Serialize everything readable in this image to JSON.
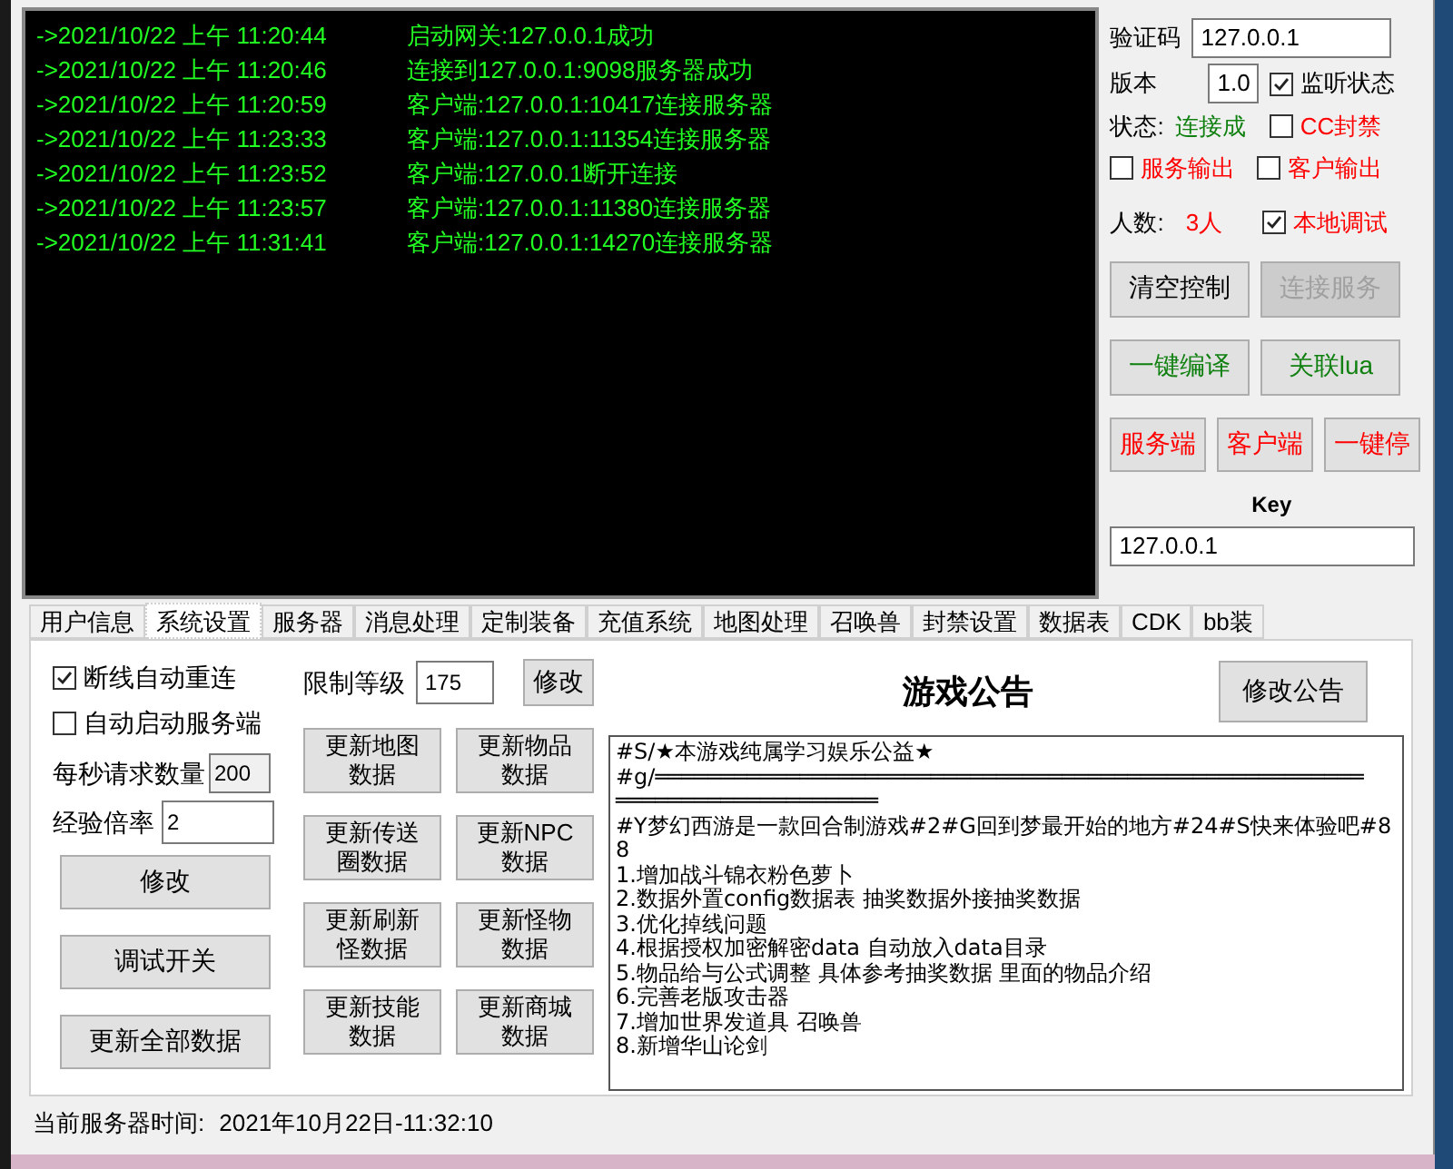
{
  "log": [
    {
      "time": "->2021/10/22 上午 11:20:44",
      "message": "启动网关:127.0.0.1成功"
    },
    {
      "time": "->2021/10/22 上午 11:20:46",
      "message": "连接到127.0.0.1:9098服务器成功"
    },
    {
      "time": "->2021/10/22 上午 11:20:59",
      "message": "客户端:127.0.0.1:10417连接服务器"
    },
    {
      "time": "->2021/10/22 上午 11:23:33",
      "message": "客户端:127.0.0.1:11354连接服务器"
    },
    {
      "time": "->2021/10/22 上午 11:23:52",
      "message": "客户端:127.0.0.1断开连接"
    },
    {
      "time": "->2021/10/22 上午 11:23:57",
      "message": "客户端:127.0.0.1:11380连接服务器"
    },
    {
      "time": "->2021/10/22 上午 11:31:41",
      "message": "客户端:127.0.0.1:14270连接服务器"
    }
  ],
  "control_panel": {
    "captcha": {
      "label": "验证码",
      "value": "127.0.0.1"
    },
    "version": {
      "label": "版本",
      "value": "1.0"
    },
    "listen_checkbox": {
      "label": "监听状态",
      "checked": true
    },
    "status": {
      "label": "状态:",
      "value": "连接成"
    },
    "cc_ban_checkbox": {
      "label": "CC封禁",
      "checked": false
    },
    "server_output_checkbox": {
      "label": "服务输出",
      "checked": false
    },
    "client_output_checkbox": {
      "label": "客户输出",
      "checked": false
    },
    "players": {
      "label": "人数:",
      "value": "3人"
    },
    "local_debug_checkbox": {
      "label": "本地调试",
      "checked": true
    },
    "button_rows": [
      [
        {
          "label": "清空控制",
          "kind": "plain",
          "disabled": false
        },
        {
          "label": "连接服务",
          "kind": "plain",
          "disabled": true
        }
      ],
      [
        {
          "label": "一键编译",
          "kind": "build",
          "disabled": false
        },
        {
          "label": "关联lua",
          "kind": "build",
          "disabled": false
        }
      ],
      [
        {
          "label": "服务端",
          "kind": "launch",
          "disabled": false
        },
        {
          "label": "客户端",
          "kind": "launch",
          "disabled": false
        },
        {
          "label": "一键停",
          "kind": "launch",
          "disabled": false
        }
      ]
    ],
    "key": {
      "label": "Key",
      "value": "127.0.0.1"
    }
  },
  "tabs": [
    {
      "label": "用户信息",
      "selected": false
    },
    {
      "label": "系统设置",
      "selected": true
    },
    {
      "label": "服务器",
      "selected": false
    },
    {
      "label": "消息处理",
      "selected": false
    },
    {
      "label": "定制装备",
      "selected": false
    },
    {
      "label": "充值系统",
      "selected": false
    },
    {
      "label": "地图处理",
      "selected": false
    },
    {
      "label": "召唤兽",
      "selected": false
    },
    {
      "label": "封禁设置",
      "selected": false
    },
    {
      "label": "数据表",
      "selected": false
    },
    {
      "label": "CDK",
      "selected": false
    },
    {
      "label": "bb装",
      "selected": false
    }
  ],
  "settings": {
    "checkboxes": [
      {
        "label": "断线自动重连",
        "checked": true
      },
      {
        "label": "自动启动服务端",
        "checked": false
      }
    ],
    "requests_per_second": {
      "label": "每秒请求数量",
      "value": "200"
    },
    "exp_rate": {
      "label": "经验倍率",
      "value": "2"
    },
    "left_buttons": [
      "修改",
      "调试开关",
      "更新全部数据"
    ],
    "level_limit": {
      "label": "限制等级",
      "value": "175",
      "button": "修改"
    },
    "update_buttons": [
      "更新地图数据",
      "更新物品数据",
      "更新传送圈数据",
      "更新NPC数据",
      "更新刷新怪数据",
      "更新怪物数据",
      "更新技能数据",
      "更新商城数据"
    ]
  },
  "announcement": {
    "title": "游戏公告",
    "button": "修改公告",
    "lines": [
      "#S/★本游戏纯属学习娱乐公益★",
      "#g/══════════════════════════════════════════════════════",
      "════════════════════",
      "#Y梦幻西游是一款回合制游戏#2#G回到梦最开始的地方#24#S快来体验吧#88",
      "1.增加战斗锦衣粉色萝卜",
      "2.数据外置config数据表 抽奖数据外接抽奖数据",
      "3.优化掉线问题",
      "4.根据授权加密解密data 自动放入data目录",
      "5.物品给与公式调整 具体参考抽奖数据 里面的物品介绍",
      "6.完善老版攻击器",
      "7.增加世界发道具 召唤兽",
      "8.新增华山论剑"
    ]
  },
  "status_bar": {
    "label": "当前服务器时间:",
    "value": "2021年10月22日-11:32:10"
  }
}
